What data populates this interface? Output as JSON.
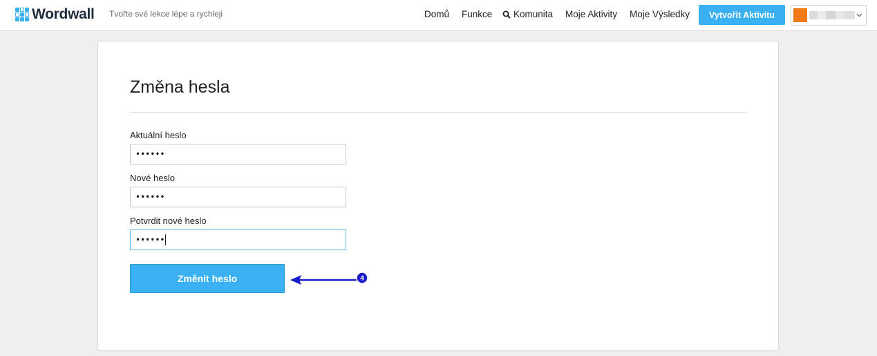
{
  "header": {
    "logo_text": "Wordwall",
    "tagline": "Tvořte své lekce lépe a rychleji",
    "nav": {
      "home": "Domů",
      "features": "Funkce",
      "community": "Komunita",
      "my_activities": "Moje Aktivity",
      "my_results": "Moje Výsledky"
    },
    "create_button": "Vytvořit Aktivitu",
    "brand_color": "#3ab1f2"
  },
  "form": {
    "title": "Změna hesla",
    "current_password": {
      "label": "Aktuální heslo",
      "value": "••••••"
    },
    "new_password": {
      "label": "Nové heslo",
      "value": "••••••"
    },
    "confirm_password": {
      "label": "Potvrdit nové heslo",
      "value": "••••••"
    },
    "submit_label": "Změnit heslo"
  },
  "annotation": {
    "step_number": "4",
    "color": "#1a1acc"
  }
}
